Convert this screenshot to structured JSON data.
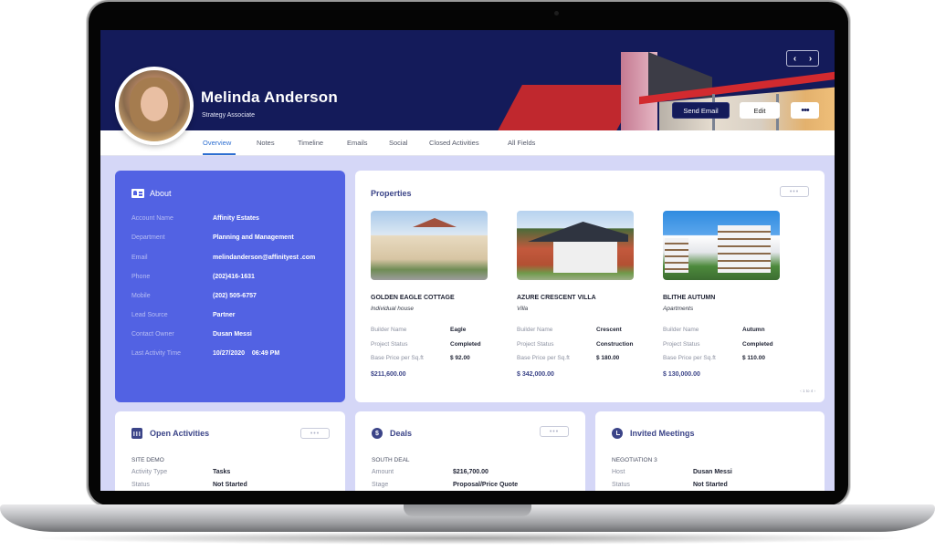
{
  "header": {
    "contact_name": "Melinda Anderson",
    "contact_title": "Strategy Associate",
    "nav_prev": "‹",
    "nav_next": "›",
    "send_email_label": "Send Email",
    "edit_label": "Edit",
    "more_label": "•••"
  },
  "tabs": [
    {
      "label": "Overview",
      "active": true
    },
    {
      "label": "Notes"
    },
    {
      "label": "Timeline"
    },
    {
      "label": "Emails"
    },
    {
      "label": "Social"
    },
    {
      "label": "Closed Activities"
    },
    {
      "label": "All Fields"
    }
  ],
  "about": {
    "title": "About",
    "fields": [
      {
        "label": "Account Name",
        "value": "Affinity Estates"
      },
      {
        "label": "Department",
        "value": "Planning and Management"
      },
      {
        "label": "Email",
        "value": "melindanderson@affinityest .com"
      },
      {
        "label": "Phone",
        "value": "(202)416-1631"
      },
      {
        "label": "Mobile",
        "value": "(202) 505-6757"
      },
      {
        "label": "Lead Source",
        "value": "Partner"
      },
      {
        "label": "Contact Owner",
        "value": "Dusan Messi"
      },
      {
        "label": "Last Activity Time",
        "value": "10/27/2020    06:49 PM"
      }
    ]
  },
  "properties": {
    "title": "Properties",
    "more_label": "•••",
    "pager": "‹ 1 to 4 ›",
    "items": [
      {
        "name": "GOLDEN EAGLE COTTAGE",
        "type": "Individual house",
        "fields": [
          {
            "label": "Builder Name",
            "value": "Eagle"
          },
          {
            "label": "Project Status",
            "value": "Completed"
          },
          {
            "label": "Base Price per Sq.ft",
            "value": "$ 92.00"
          }
        ],
        "total": "$211,600.00"
      },
      {
        "name": "AZURE CRESCENT VILLA",
        "type": "Villa",
        "fields": [
          {
            "label": "Builder Name",
            "value": "Crescent"
          },
          {
            "label": "Project Status",
            "value": "Construction"
          },
          {
            "label": "Base Price per Sq.ft",
            "value": "$ 180.00"
          }
        ],
        "total": "$ 342,000.00"
      },
      {
        "name": "BLITHE AUTUMN",
        "type": "Apartments",
        "fields": [
          {
            "label": "Builder Name",
            "value": "Autumn"
          },
          {
            "label": "Project Status",
            "value": "Completed"
          },
          {
            "label": "Base Price per Sq.ft",
            "value": "$ 110.00"
          }
        ],
        "total": "$ 130,000.00"
      }
    ]
  },
  "open_activities": {
    "title": "Open Activities",
    "more_label": "•••",
    "subtitle": "SITE DEMO",
    "fields": [
      {
        "label": "Activity Type",
        "value": "Tasks"
      },
      {
        "label": "Status",
        "value": "Not Started"
      }
    ]
  },
  "deals": {
    "title": "Deals",
    "icon_glyph": "$",
    "more_label": "•••",
    "subtitle": "SOUTH DEAL",
    "fields": [
      {
        "label": "Amount",
        "value": "$216,700.00"
      },
      {
        "label": "Stage",
        "value": "Proposal/Price Quote"
      }
    ]
  },
  "invited_meetings": {
    "title": "Invited Meetings",
    "subtitle": "NEGOTIATION 3",
    "fields": [
      {
        "label": "Host",
        "value": "Dusan Messi"
      },
      {
        "label": "Status",
        "value": "Not Started"
      }
    ]
  },
  "colors": {
    "banner": "#141b5a",
    "about_card": "#5262e3",
    "accent_tab": "#2e6fd1",
    "page_bg": "#d5d7f7",
    "title_text": "#3b4488"
  }
}
